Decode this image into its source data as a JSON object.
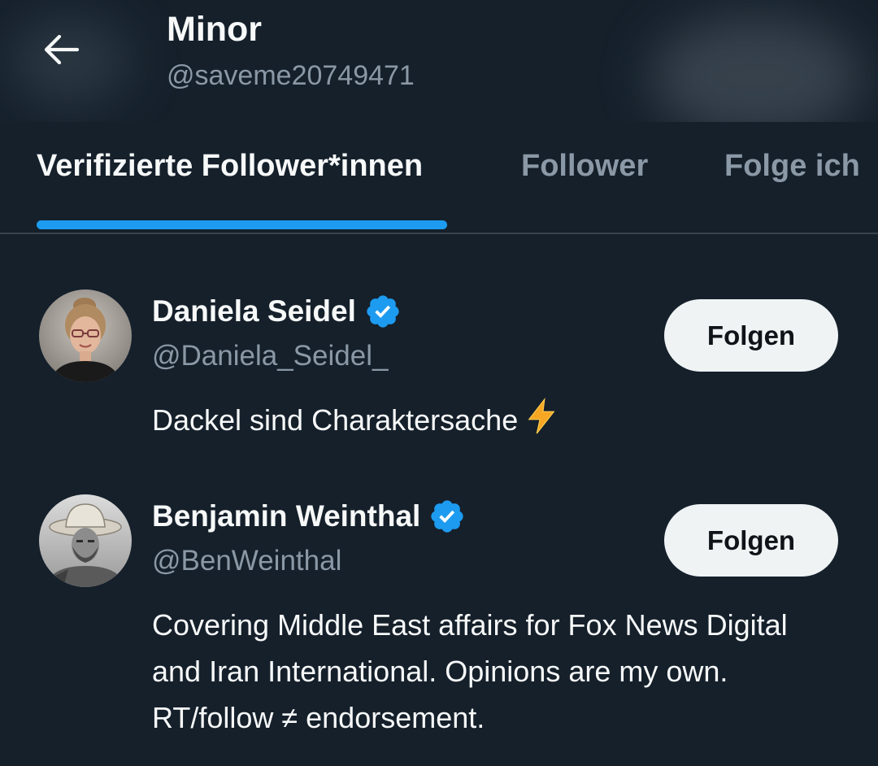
{
  "header": {
    "title": "Minor",
    "handle": "@saveme20749471"
  },
  "tabs": [
    {
      "label": "Verifizierte Follower*innen",
      "active": true
    },
    {
      "label": "Follower",
      "active": false
    },
    {
      "label": "Folge ich",
      "active": false
    }
  ],
  "users": [
    {
      "name": "Daniela Seidel",
      "handle": "@Daniela_Seidel_",
      "bio": "Dackel sind Charaktersache",
      "bio_emoji_icon": "high-voltage-icon",
      "verified": true,
      "follow_label": "Folgen"
    },
    {
      "name": "Benjamin Weinthal",
      "handle": "@BenWeinthal",
      "bio": "Covering Middle East affairs for Fox News Digital and Iran International. Opinions are my own. RT/follow ≠ endorsement.",
      "verified": true,
      "follow_label": "Folgen"
    }
  ],
  "colors": {
    "background": "#15202b",
    "accent": "#1d9bf0",
    "text_primary": "#f7f9f9",
    "text_secondary": "#8b98a5",
    "button_bg": "#eff3f4",
    "divider": "#38444d"
  }
}
